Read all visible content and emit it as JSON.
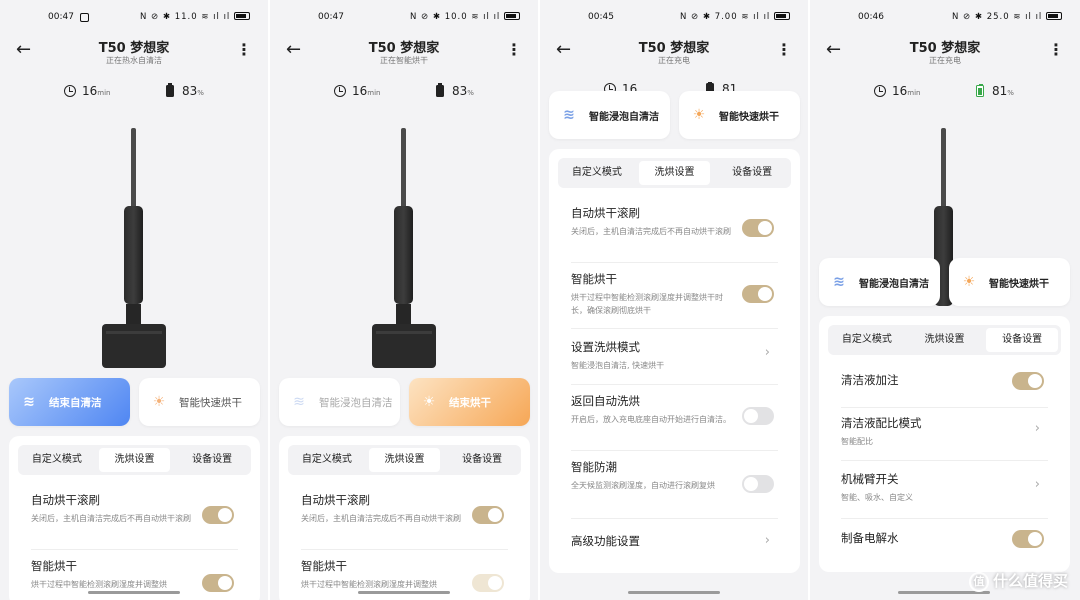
{
  "screens": [
    {
      "time": "00:47",
      "status_right": "N ⊘ ✱ 11.0 ≋ ıl ıl",
      "title": "T50 梦想家",
      "subtitle": "正在热水自清洁",
      "duration_value": "16",
      "duration_unit": "min",
      "battery_value": "83",
      "battery_unit": "%",
      "mode_left": "结束自清洁",
      "mode_right": "智能快速烘干",
      "tabs": [
        "自定义模式",
        "洗烘设置",
        "设备设置"
      ],
      "row1_name": "自动烘干滚刷",
      "row1_desc": "关闭后，主机自清洁完成后不再自动烘干滚刷",
      "row2_name": "智能烘干",
      "row2_desc": "烘干过程中智能检测滚刷湿度并调整烘"
    },
    {
      "time": "00:47",
      "status_right": "N ⊘ ✱ 10.0 ≋ ıl ıl",
      "title": "T50 梦想家",
      "subtitle": "正在智能烘干",
      "duration_value": "16",
      "duration_unit": "min",
      "battery_value": "83",
      "battery_unit": "%",
      "mode_left": "智能浸泡自清洁",
      "mode_right": "结束烘干",
      "tabs": [
        "自定义模式",
        "洗烘设置",
        "设备设置"
      ],
      "row1_name": "自动烘干滚刷",
      "row1_desc": "关闭后，主机自清洁完成后不再自动烘干滚刷",
      "row2_name": "智能烘干",
      "row2_desc": "烘干过程中智能检测滚刷湿度并调整烘"
    },
    {
      "time": "00:45",
      "status_right": "N ⊘ ✱ 7.00 ≋ ıl ıl",
      "title": "T50 梦想家",
      "subtitle": "正在充电",
      "duration_value": "16",
      "battery_value": "81",
      "mode_left": "智能浸泡自清洁",
      "mode_right": "智能快速烘干",
      "tabs": [
        "自定义模式",
        "洗烘设置",
        "设备设置"
      ],
      "rows": [
        {
          "name": "自动烘干滚刷",
          "desc": "关闭后，主机自清洁完成后不再自动烘干滚刷"
        },
        {
          "name": "智能烘干",
          "desc": "烘干过程中智能检测滚刷湿度并调整烘干时长，确保滚刷彻底烘干"
        },
        {
          "name": "设置洗烘模式",
          "desc": "智能浸泡自清洁, 快速烘干"
        },
        {
          "name": "返回自动洗烘",
          "desc": "开启后，放入充电底座自动开始进行自清洁。"
        },
        {
          "name": "智能防潮",
          "desc": "全天候监测滚刷湿度，自动进行滚刷复烘"
        },
        {
          "name": "高级功能设置",
          "desc": ""
        }
      ]
    },
    {
      "time": "00:46",
      "status_right": "N ⊘ ✱ 25.0 ≋ ıl ıl",
      "title": "T50 梦想家",
      "subtitle": "正在充电",
      "duration_value": "16",
      "duration_unit": "min",
      "battery_value": "81",
      "battery_unit": "%",
      "mode_left": "智能浸泡自清洁",
      "mode_right": "智能快速烘干",
      "tabs": [
        "自定义模式",
        "洗烘设置",
        "设备设置"
      ],
      "rows": [
        {
          "name": "清洁液加注",
          "desc": ""
        },
        {
          "name": "清洁液配比模式",
          "desc": "智能配比"
        },
        {
          "name": "机械臂开关",
          "desc": "智能、吸水、自定义"
        },
        {
          "name": "制备电解水",
          "desc": ""
        }
      ]
    }
  ],
  "watermark": "什么值得买",
  "watermark_logo": "值",
  "icons": {
    "wave": "≋",
    "sun": "☀",
    "back": "←",
    "more": "⋮",
    "chevron": "›"
  }
}
